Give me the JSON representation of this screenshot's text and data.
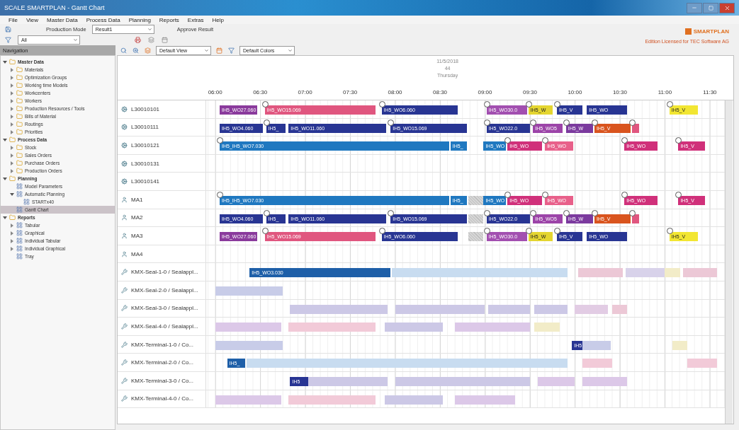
{
  "window": {
    "title": "SCALE SMARTPLAN - Gantt Chart"
  },
  "menu": [
    "File",
    "View",
    "Master Data",
    "Process Data",
    "Planning",
    "Reports",
    "Extras",
    "Help"
  ],
  "toolbar": {
    "mode_label": "Production Mode",
    "result_select": "Result1",
    "approve_button": "Approve Result",
    "filter_select": "All",
    "view_select": "Default View",
    "colors_select": "Default Colors"
  },
  "brand": {
    "logo": "SMARTPLAN",
    "license": "Edition Licensed for TEC Software AG"
  },
  "navigation": {
    "title": "Navigation",
    "items": [
      {
        "label": "Master Data",
        "kind": "folder",
        "expanded": true,
        "selected": false,
        "children": [
          {
            "label": "Materials",
            "kind": "folder",
            "expanded": false,
            "selected": false
          },
          {
            "label": "Optimization Groups",
            "kind": "folder",
            "expanded": false,
            "selected": false
          },
          {
            "label": "Working time Models",
            "kind": "folder",
            "expanded": false,
            "selected": false
          },
          {
            "label": "Workcenters",
            "kind": "folder",
            "expanded": false,
            "selected": false
          },
          {
            "label": "Workers",
            "kind": "folder",
            "expanded": false,
            "selected": false
          },
          {
            "label": "Production Resources / Tools",
            "kind": "folder",
            "expanded": false,
            "selected": false
          },
          {
            "label": "Bills of Material",
            "kind": "folder",
            "expanded": false,
            "selected": false
          },
          {
            "label": "Routings",
            "kind": "folder",
            "expanded": false,
            "selected": false
          },
          {
            "label": "Priorities",
            "kind": "folder",
            "expanded": false,
            "selected": false
          }
        ]
      },
      {
        "label": "Process Data",
        "kind": "folder",
        "expanded": true,
        "selected": false,
        "children": [
          {
            "label": "Stock",
            "kind": "folder",
            "expanded": false,
            "selected": false
          },
          {
            "label": "Sales Orders",
            "kind": "folder",
            "expanded": false,
            "selected": false
          },
          {
            "label": "Purchase Orders",
            "kind": "folder",
            "expanded": false,
            "selected": false
          },
          {
            "label": "Production Orders",
            "kind": "folder",
            "expanded": false,
            "selected": false
          }
        ]
      },
      {
        "label": "Planning",
        "kind": "folder",
        "expanded": true,
        "selected": false,
        "children": [
          {
            "label": "Model Parameters",
            "kind": "page",
            "selected": false
          },
          {
            "label": "Automatic Planning",
            "kind": "page",
            "expanded": true,
            "selected": false,
            "children": [
              {
                "label": "STARTx40",
                "kind": "page",
                "selected": false
              }
            ]
          },
          {
            "label": "Gantt Chart",
            "kind": "page",
            "selected": true
          }
        ]
      },
      {
        "label": "Reports",
        "kind": "folder",
        "expanded": true,
        "selected": false,
        "children": [
          {
            "label": "Tabular",
            "kind": "page",
            "expanded": false,
            "selected": false
          },
          {
            "label": "Graphical",
            "kind": "page",
            "expanded": false,
            "selected": false
          },
          {
            "label": "Individual Tabular",
            "kind": "page",
            "expanded": false,
            "selected": false
          },
          {
            "label": "Individual Graphical",
            "kind": "page",
            "expanded": false,
            "selected": false
          },
          {
            "label": "Tray",
            "kind": "page",
            "selected": false
          }
        ]
      }
    ]
  },
  "gantt": {
    "date": "11/5/2018",
    "week": "44",
    "weekday": "Thursday",
    "ticks": [
      "06:00",
      "06:30",
      "07:00",
      "07:30",
      "08:00",
      "08:30",
      "09:00",
      "09:30",
      "10:00",
      "10:30",
      "11:00",
      "11:30"
    ],
    "rows": [
      {
        "label": "L30010101",
        "kind": "line",
        "bars": [
          {
            "label": "IH5_WO27.060",
            "color": "#8a3a9c",
            "kind": "solid",
            "pin": false
          },
          {
            "label": "IH5_WO15.069",
            "color": "#e0567f",
            "kind": "solid",
            "pin": true
          },
          {
            "label": "IH5_WO6.060",
            "color": "#283593",
            "kind": "solid",
            "pin": true
          },
          {
            "label": "IH5_WO30.0",
            "color": "#a24fb0",
            "kind": "solid",
            "pin": true
          },
          {
            "label": "IH5_W",
            "color": "#e4d530",
            "kind": "solid",
            "pin": true
          },
          {
            "label": "IH5_V",
            "color": "#283593",
            "kind": "solid",
            "pin": true
          },
          {
            "label": "IH5_WO",
            "color": "#283593",
            "kind": "solid",
            "pin": false
          },
          {
            "label": "IH5_V",
            "color": "#f2e632",
            "kind": "solid",
            "pin": true
          }
        ]
      },
      {
        "label": "L30010111",
        "kind": "line",
        "bars": [
          {
            "label": "IH5_WO4.060",
            "color": "#283593",
            "kind": "solid",
            "pin": false
          },
          {
            "label": "IH5_",
            "color": "#283593",
            "kind": "solid",
            "pin": true
          },
          {
            "label": "IH5_WO11.060",
            "color": "#283593",
            "kind": "solid",
            "pin": false
          },
          {
            "label": "IH5_WO15.069",
            "color": "#283593",
            "kind": "solid",
            "pin": true
          },
          {
            "label": "IH5_WO22.0",
            "color": "#283593",
            "kind": "solid",
            "pin": true
          },
          {
            "label": "IH5_WO5",
            "color": "#9c44a8",
            "kind": "solid",
            "pin": true
          },
          {
            "label": "IH5_W",
            "color": "#7b3a9e",
            "kind": "solid",
            "pin": true
          },
          {
            "label": "IH5_V",
            "color": "#d9541e",
            "kind": "solid",
            "pin": true
          },
          {
            "color": "#e0567f",
            "kind": "solid",
            "pin": true
          }
        ]
      },
      {
        "label": "L30010121",
        "kind": "line",
        "bars": [
          {
            "label": "IH5_IH5_WO7.030",
            "color": "#1f78c0",
            "kind": "solid",
            "pin": true
          },
          {
            "label": "IH5_",
            "color": "#1f78c0",
            "kind": "solid",
            "pin": false
          },
          {
            "label": "IH5_WO",
            "color": "#1f78c0",
            "kind": "solid",
            "pin": false
          },
          {
            "label": "IH5_WO",
            "color": "#d0307a",
            "kind": "solid",
            "pin": true
          },
          {
            "label": "IH5_WO",
            "color": "#e8608a",
            "kind": "solid",
            "pin": true
          },
          {
            "label": "IH5_WO",
            "color": "#d0307a",
            "kind": "solid",
            "pin": true
          },
          {
            "label": "IH5_V",
            "color": "#d0307a",
            "kind": "solid",
            "pin": true
          }
        ]
      },
      {
        "label": "L30010131",
        "kind": "line",
        "bars": []
      },
      {
        "label": "L30010141",
        "kind": "line",
        "bars": []
      },
      {
        "label": "MA1",
        "kind": "worker",
        "bars": [
          {
            "label": "IH5_IH5_WO7.030",
            "color": "#1f78c0",
            "kind": "solid",
            "pin": true
          },
          {
            "label": "IH5_",
            "color": "#1f78c0",
            "kind": "solid",
            "pin": false
          },
          {
            "color": "#d6d6d6",
            "kind": "break",
            "pin": false
          },
          {
            "label": "IH5_WO",
            "color": "#1f78c0",
            "kind": "solid",
            "pin": false
          },
          {
            "label": "IH5_WO",
            "color": "#d0307a",
            "kind": "solid",
            "pin": true
          },
          {
            "label": "IH5_WO",
            "color": "#e8608a",
            "kind": "solid",
            "pin": true
          },
          {
            "label": "IH5_WO",
            "color": "#d0307a",
            "kind": "solid",
            "pin": true
          },
          {
            "label": "IH5_V",
            "color": "#d0307a",
            "kind": "solid",
            "pin": true
          }
        ]
      },
      {
        "label": "MA2",
        "kind": "worker",
        "bars": [
          {
            "label": "IH5_WO4.060",
            "color": "#283593",
            "kind": "solid",
            "pin": false
          },
          {
            "label": "IH5_",
            "color": "#283593",
            "kind": "solid",
            "pin": true
          },
          {
            "label": "IH5_WO11.060",
            "color": "#283593",
            "kind": "solid",
            "pin": false
          },
          {
            "label": "IH5_WO15.069",
            "color": "#283593",
            "kind": "solid",
            "pin": true
          },
          {
            "color": "#d6d6d6",
            "kind": "break",
            "pin": false
          },
          {
            "label": "IH5_WO22.0",
            "color": "#283593",
            "kind": "solid",
            "pin": true
          },
          {
            "label": "IH5_WO5",
            "color": "#9c44a8",
            "kind": "solid",
            "pin": true
          },
          {
            "label": "IH5_W",
            "color": "#7b3a9e",
            "kind": "solid",
            "pin": true
          },
          {
            "label": "IH5_V",
            "color": "#d9541e",
            "kind": "solid",
            "pin": true
          },
          {
            "color": "#e0567f",
            "kind": "solid",
            "pin": true
          }
        ]
      },
      {
        "label": "MA3",
        "kind": "worker",
        "bars": [
          {
            "label": "IH5_WO27.060",
            "color": "#8a3a9c",
            "kind": "solid",
            "pin": false
          },
          {
            "label": "IH5_WO15.069",
            "color": "#e0567f",
            "kind": "solid",
            "pin": true
          },
          {
            "label": "IH5_WO6.060",
            "color": "#283593",
            "kind": "solid",
            "pin": true
          },
          {
            "color": "#d6d6d6",
            "kind": "break",
            "pin": false
          },
          {
            "label": "IH5_WO30.0",
            "color": "#a24fb0",
            "kind": "solid",
            "pin": true
          },
          {
            "label": "IH5_W",
            "color": "#e4d530",
            "kind": "solid",
            "pin": true
          },
          {
            "label": "IH5_V",
            "color": "#283593",
            "kind": "solid",
            "pin": true
          },
          {
            "label": "IH5_WO",
            "color": "#283593",
            "kind": "solid",
            "pin": false
          },
          {
            "label": "IH5_V",
            "color": "#f2e632",
            "kind": "solid",
            "pin": true
          }
        ]
      },
      {
        "label": "MA4",
        "kind": "worker",
        "bars": []
      },
      {
        "label": "KMX-Seal-1-0 / Sealappl...",
        "kind": "tool",
        "bars": [
          {
            "label": "IH5_WO3.030",
            "color": "#1e5fa8",
            "kind": "solid",
            "pin": false
          },
          {
            "color": "#c8dcf0",
            "kind": "faded",
            "pin": false
          },
          {
            "color": "#ecc8d6",
            "kind": "faded",
            "pin": false
          },
          {
            "color": "#d8d2ea",
            "kind": "faded",
            "pin": false
          },
          {
            "color": "#f2ecc8",
            "kind": "faded",
            "pin": false
          },
          {
            "color": "#ecc8d6",
            "kind": "faded",
            "pin": false
          }
        ]
      },
      {
        "label": "KMX-Seal-2-0 / Sealappl...",
        "kind": "tool",
        "bars": [
          {
            "color": "#c8cce8",
            "kind": "faded",
            "pin": false
          }
        ]
      },
      {
        "label": "KMX-Seal-3-0 / Sealappl...",
        "kind": "tool",
        "bars": [
          {
            "color": "#ccc8e6",
            "kind": "faded",
            "pin": false
          },
          {
            "color": "#ccc8e6",
            "kind": "faded",
            "pin": false
          },
          {
            "color": "#ccc8e6",
            "kind": "faded",
            "pin": false
          },
          {
            "color": "#ccc8e6",
            "kind": "faded",
            "pin": false
          },
          {
            "color": "#e2cce4",
            "kind": "faded",
            "pin": false
          },
          {
            "color": "#ecc8d6",
            "kind": "faded",
            "pin": false
          }
        ]
      },
      {
        "label": "KMX-Seal-4-0 / Sealappl...",
        "kind": "tool",
        "bars": [
          {
            "color": "#dcc8e8",
            "kind": "faded",
            "pin": false
          },
          {
            "color": "#f2cad8",
            "kind": "faded",
            "pin": false
          },
          {
            "color": "#ccc8e6",
            "kind": "faded",
            "pin": false
          },
          {
            "color": "#dcc8e8",
            "kind": "faded",
            "pin": false
          },
          {
            "color": "#f2ecc8",
            "kind": "faded",
            "pin": false
          }
        ]
      },
      {
        "label": "KMX-Terminal-1-0 / Co...",
        "kind": "tool",
        "bars": [
          {
            "color": "#c8cce8",
            "kind": "faded",
            "pin": false
          },
          {
            "label": "IH5",
            "color": "#283593",
            "kind": "solid",
            "pin": false
          },
          {
            "color": "#c8cce8",
            "kind": "faded",
            "pin": false
          },
          {
            "color": "#f2ecc8",
            "kind": "faded",
            "pin": false
          }
        ]
      },
      {
        "label": "KMX-Terminal-2-0 / Co...",
        "kind": "tool",
        "bars": [
          {
            "label": "IH5_",
            "color": "#1e5fa8",
            "kind": "solid",
            "pin": false
          },
          {
            "color": "#c8dcf0",
            "kind": "faded",
            "pin": false
          },
          {
            "color": "#f2cad8",
            "kind": "faded",
            "pin": false
          },
          {
            "color": "#f2cad8",
            "kind": "faded",
            "pin": false
          }
        ]
      },
      {
        "label": "KMX-Terminal-3-0 / Co...",
        "kind": "tool",
        "bars": [
          {
            "label": "IH5",
            "color": "#283593",
            "kind": "solid",
            "pin": false
          },
          {
            "color": "#ccc8e6",
            "kind": "faded",
            "pin": false
          },
          {
            "color": "#ccc8e6",
            "kind": "faded",
            "pin": false
          },
          {
            "color": "#dcc8e8",
            "kind": "faded",
            "pin": false
          },
          {
            "color": "#dcc8e8",
            "kind": "faded",
            "pin": false
          }
        ]
      },
      {
        "label": "KMX-Terminal-4-0 / Co...",
        "kind": "tool",
        "bars": [
          {
            "color": "#dcc8e8",
            "kind": "faded",
            "pin": false
          },
          {
            "color": "#f2cad8",
            "kind": "faded",
            "pin": false
          },
          {
            "color": "#ccc8e6",
            "kind": "faded",
            "pin": false
          },
          {
            "color": "#dcc8e8",
            "kind": "faded",
            "pin": false
          }
        ]
      }
    ]
  }
}
